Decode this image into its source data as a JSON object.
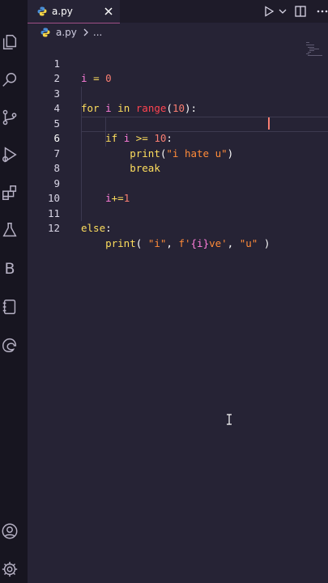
{
  "tab": {
    "filename": "a.py",
    "close_icon": "close-icon"
  },
  "toolbar": {
    "run_icon": "play-icon",
    "run_menu_icon": "chevron-down-icon",
    "split_icon": "split-editor-icon",
    "more_icon": "ellipsis-icon"
  },
  "breadcrumb": {
    "file": "a.py",
    "more": "..."
  },
  "activity_icons": [
    "explorer-icon",
    "search-icon",
    "source-control-icon",
    "run-debug-icon",
    "extensions-icon",
    "testing-icon",
    "b-icon",
    "notebook-icon",
    "edge-icon",
    "account-icon",
    "settings-icon"
  ],
  "activity_b_letter": "B",
  "editor": {
    "active_line": 6,
    "lines": [
      {
        "n": "1",
        "text": "i = 0"
      },
      {
        "n": "2",
        "text": ""
      },
      {
        "n": "3",
        "text": "for i in range(10):"
      },
      {
        "n": "4",
        "text": ""
      },
      {
        "n": "5",
        "text": "    if i >= 10:"
      },
      {
        "n": "6",
        "text": "        print(\"i hate u\")"
      },
      {
        "n": "7",
        "text": "        break"
      },
      {
        "n": "8",
        "text": ""
      },
      {
        "n": "9",
        "text": "    i+=1"
      },
      {
        "n": "10",
        "text": ""
      },
      {
        "n": "11",
        "text": "else:"
      },
      {
        "n": "12",
        "text": "    print( \"i\", f'{i}ve', \"u\" )"
      }
    ]
  },
  "colors": {
    "background": "#262335",
    "activity_bar": "#171520",
    "keyword": "#fede5d",
    "variable": "#ff7edb",
    "number": "#f97e72",
    "string": "#ff8b39",
    "builtin": "#fe4450",
    "tab_accent": "#a04f87"
  }
}
